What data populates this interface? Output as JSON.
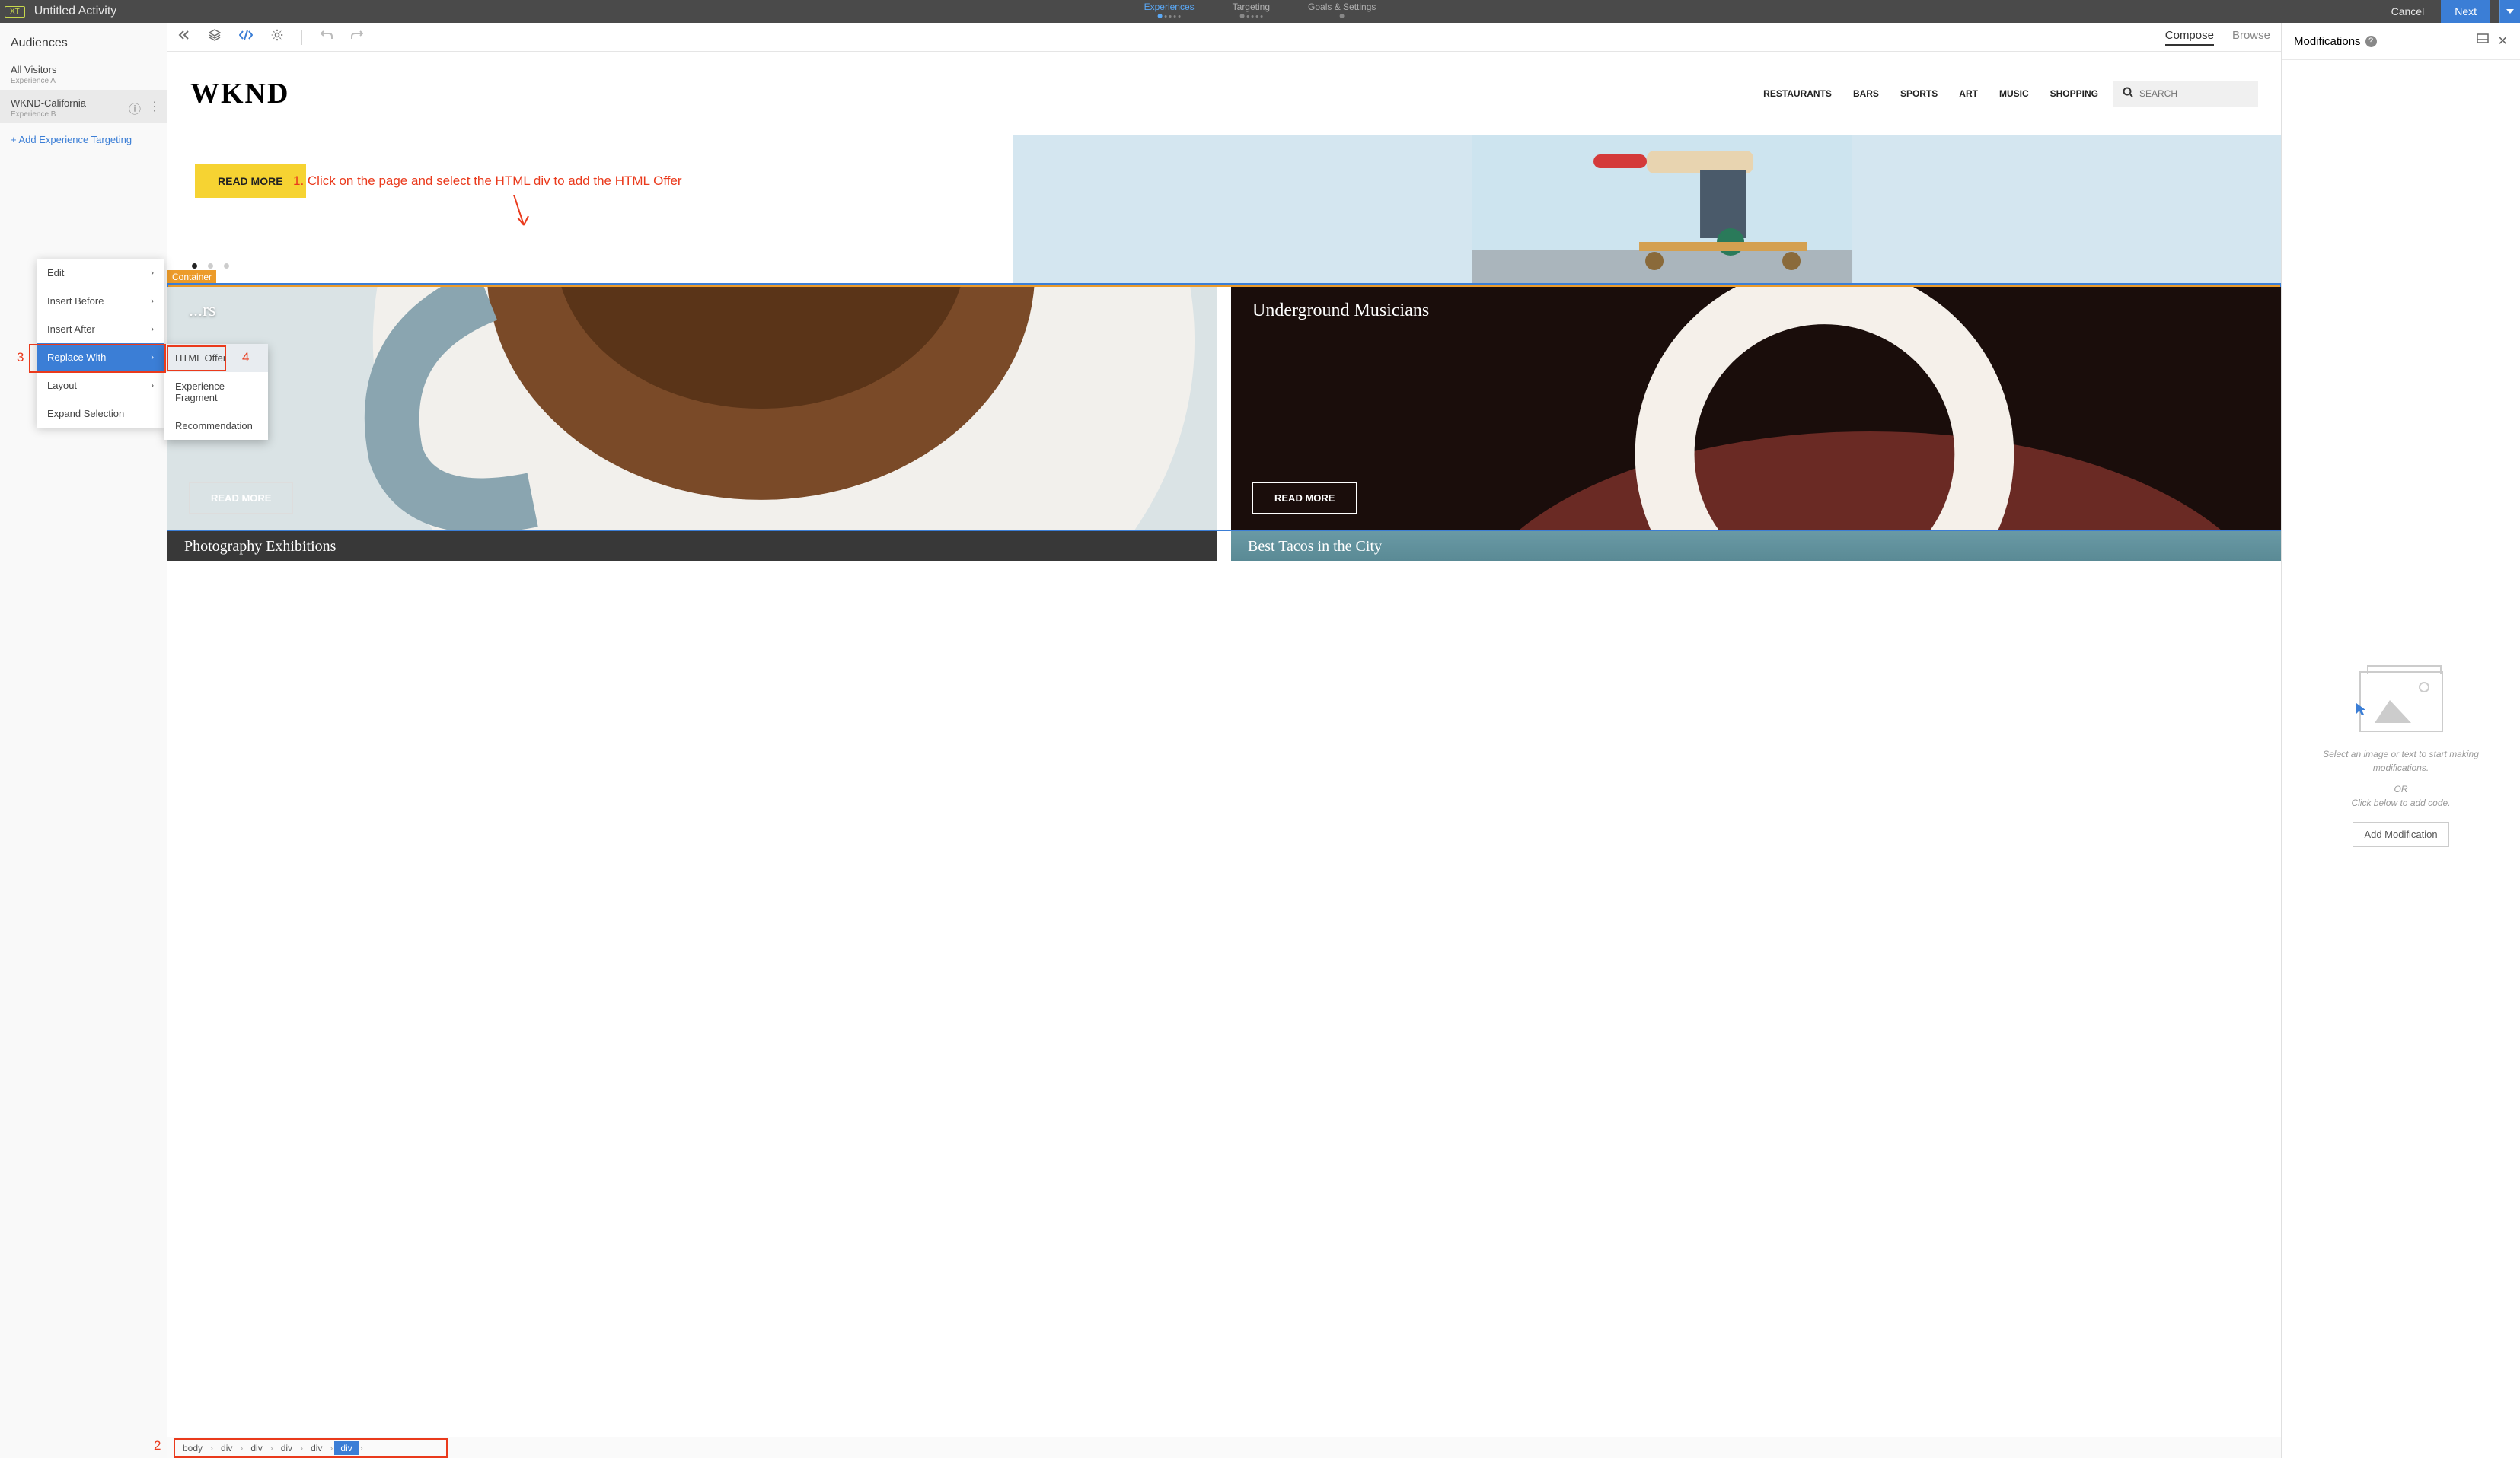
{
  "topbar": {
    "badge": "XT",
    "title": "Untitled Activity",
    "steps": [
      "Experiences",
      "Targeting",
      "Goals & Settings"
    ],
    "cancel": "Cancel",
    "next": "Next"
  },
  "left": {
    "title": "Audiences",
    "audiences": [
      {
        "name": "All Visitors",
        "exp": "Experience A"
      },
      {
        "name": "WKND-California",
        "exp": "Experience B"
      }
    ],
    "add": "+   Add Experience Targeting"
  },
  "toolbar": {
    "compose": "Compose",
    "browse": "Browse"
  },
  "site": {
    "logo": "WKND",
    "nav": [
      "RESTAURANTS",
      "BARS",
      "SPORTS",
      "ART",
      "MUSIC",
      "SHOPPING"
    ],
    "search_placeholder": "SEARCH",
    "readmore": "READ MORE",
    "container_label": "Container",
    "card1_title": "...rs",
    "card2_title": "Underground Musicians",
    "card_btn": "READ MORE",
    "card3_title": "Photography Exhibitions",
    "card4_title": "Best Tacos in the City"
  },
  "dompath": [
    "body",
    "div",
    "div",
    "div",
    "div",
    "div"
  ],
  "right": {
    "title": "Modifications",
    "empty1": "Select an image or text to start making modifications.",
    "or": "OR",
    "empty2": "Click below to add code.",
    "btn": "Add Modification"
  },
  "ctx": {
    "items": [
      "Edit",
      "Insert Before",
      "Insert After",
      "Replace With",
      "Layout",
      "Expand Selection"
    ],
    "sub": [
      "HTML Offer",
      "Experience Fragment",
      "Recommendation"
    ]
  },
  "anno": {
    "main": "1. Click on the page and select the HTML div to add the HTML Offer",
    "n2": "2",
    "n3": "3",
    "n4": "4"
  }
}
